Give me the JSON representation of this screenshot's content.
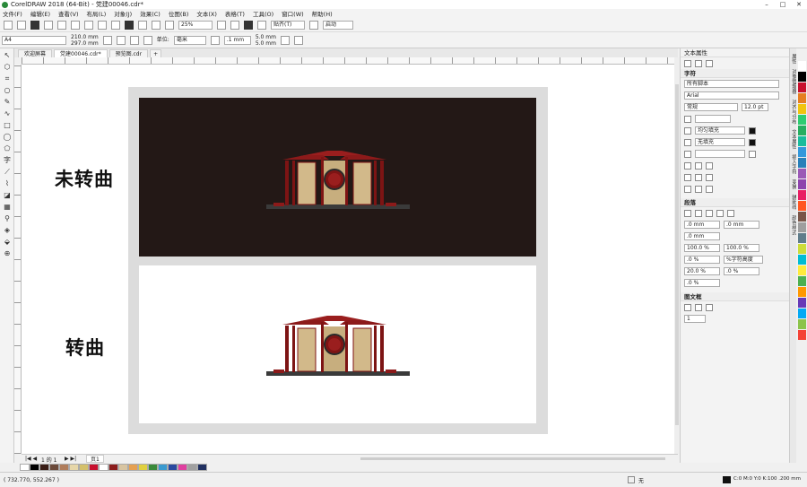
{
  "window": {
    "title": "CorelDRAW 2018 (64-Bit) - 党建00046.cdr*"
  },
  "menu": [
    "文件(F)",
    "编辑(E)",
    "查看(V)",
    "布局(L)",
    "对象(J)",
    "效果(C)",
    "位图(B)",
    "文本(X)",
    "表格(T)",
    "工具(O)",
    "窗口(W)",
    "帮助(H)"
  ],
  "toolbar": {
    "zoom": "25%",
    "snap": "贴齐(T)",
    "launch": "启动"
  },
  "propbar": {
    "page_size": "A4",
    "width": "210.0 mm",
    "height": "297.0 mm",
    "units_label": "单位:",
    "units": "毫米",
    "nudge": ".1 mm",
    "dup_x": "5.0 mm",
    "dup_y": "5.0 mm"
  },
  "tabs": [
    "欢迎屏幕",
    "党建00046.cdr*",
    "预览图.cdr"
  ],
  "canvas": {
    "label_top": "未转曲",
    "label_bottom": "转曲"
  },
  "page_nav": {
    "counter": "1 的 1",
    "page_tab": "页1"
  },
  "status": {
    "coords": "( 732.770, 552.267 )",
    "fill_label": "无",
    "outline_info": "C:0 M:0 Y:0 K:100  .200 mm"
  },
  "panel": {
    "title": "文本属性",
    "char_head": "字符",
    "script": "所有脚本",
    "font": "Arial",
    "style": "常规",
    "size": "12.0 pt",
    "fill_type": "均匀填充",
    "bg_fill": "无填充",
    "para_head": "段落",
    "indent1": ".0 mm",
    "indent2": ".0 mm",
    "indent3": ".0 mm",
    "spacing1": "100.0 %",
    "spacing2": "100.0 %",
    "spacing_unit": "%字符高度",
    "spacing3": ".0 %",
    "spacing4": ".0 %",
    "spacing5": "20.0 %",
    "spacing6": ".0 %",
    "frame_head": "图文框",
    "columns": "1"
  },
  "right_tabs": [
    "属性",
    "对象管理器",
    "对齐与分布",
    "文本属性",
    "插入字符",
    "变换",
    "辅助线",
    "颜色样式"
  ],
  "palette": [
    "#ffffff",
    "#000000",
    "#3a1d16",
    "#6b4a3a",
    "#b07c5a",
    "#e6d6a8",
    "#d4c06a",
    "#c8102e",
    "#ffffff",
    "#8c1c1c",
    "#d8c4a0",
    "#e6a050",
    "#e0d040",
    "#3a8a3a",
    "#3a9ad0",
    "#2a4aa0",
    "#e040a0",
    "#a0a0a0",
    "#203060"
  ],
  "color_strip": [
    "#ffffff",
    "#000000",
    "#c8102e",
    "#e67e22",
    "#f1c40f",
    "#2ecc71",
    "#27ae60",
    "#1abc9c",
    "#3498db",
    "#2980b9",
    "#9b59b6",
    "#8e44ad",
    "#e91e63",
    "#ff5722",
    "#795548",
    "#9e9e9e",
    "#607d8b",
    "#cddc39",
    "#00bcd4",
    "#ffeb3b",
    "#4caf50",
    "#ff9800",
    "#673ab7",
    "#03a9f4",
    "#8bc34a",
    "#f44336"
  ]
}
